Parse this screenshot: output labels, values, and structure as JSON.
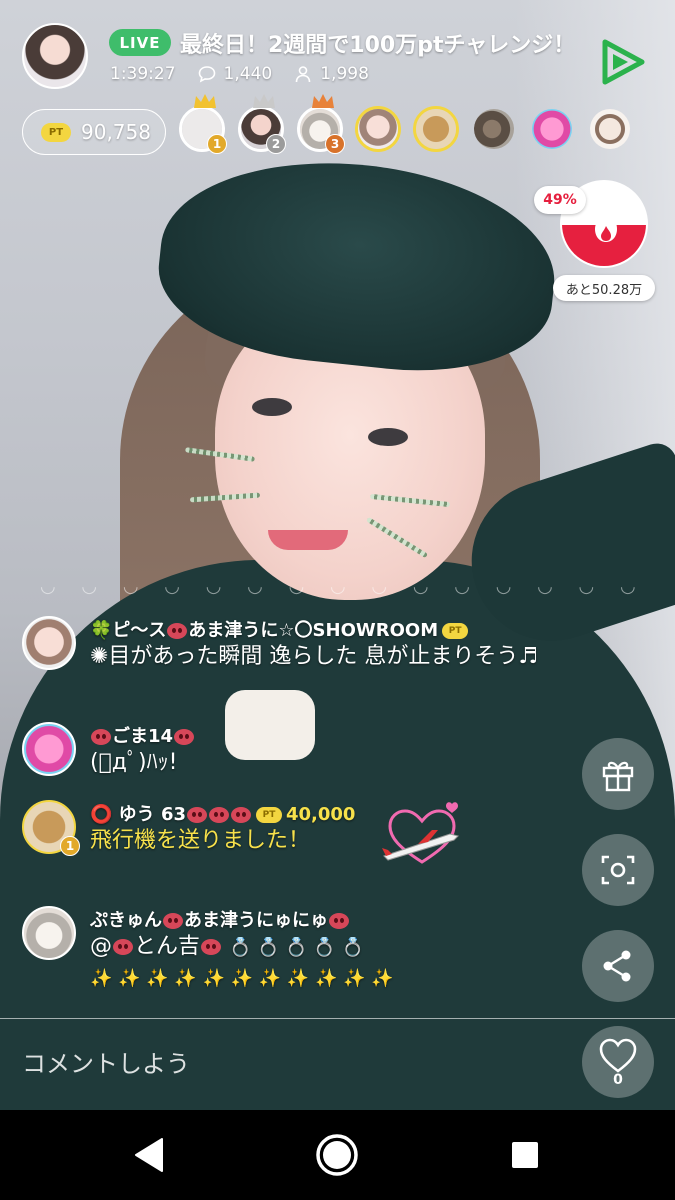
{
  "header": {
    "live_label": "LIVE",
    "title": "最終日！2週間で100万ptチャレンジ！",
    "elapsed_time": "1:39:27",
    "comment_count": "1,440",
    "viewer_count": "1,998"
  },
  "points": {
    "chip": "PT",
    "value": "90,758"
  },
  "ranking": [
    {
      "rank": "1",
      "crown_color": "#f2c230",
      "badge_color": "#e2a92a"
    },
    {
      "rank": "2",
      "crown_color": "#c9c9c9",
      "badge_color": "#9b9b9b"
    },
    {
      "rank": "3",
      "crown_color": "#e8823a",
      "badge_color": "#d8722a"
    }
  ],
  "gauge": {
    "percent_label": "49%",
    "percent": 0.49,
    "remaining": "あと50.28万",
    "color": "#e6203f"
  },
  "comments": [
    {
      "user_prefix": "🍀ピ〜ス",
      "user_mid": "あま津うに☆〇SHOWROOM",
      "pt_badge": "PT",
      "text": "✺目があった瞬間 逸らした 息が止まりそう♬"
    },
    {
      "user_prefix": "",
      "user_mid": "ごま14",
      "text": "(ﾟдﾟ)ﾊｯ!"
    },
    {
      "user_prefix": "⭕ ゆう 63",
      "pt_badge": "PT",
      "points": "40,000",
      "rank": "1",
      "text": "飛行機を送りました！"
    },
    {
      "user_prefix": "ぷきゅん",
      "user_mid": "あま津うにゅにゅ",
      "text_prefix": "@",
      "text_mid": "とん吉",
      "rings": "💍 💍 💍 💍 💍",
      "sparkles": "✨ ✨ ✨ ✨ ✨ ✨ ✨ ✨ ✨ ✨ ✨"
    }
  ],
  "input": {
    "placeholder": "コメントしよう"
  },
  "like_count": "0",
  "icons": {
    "comment": "speech-bubble-icon",
    "viewers": "person-icon",
    "play": "play-triangle-icon",
    "flame": "flame-icon",
    "gift": "gift-icon",
    "screenshot": "screenshot-icon",
    "share": "share-icon",
    "heart": "heart-icon",
    "back": "back-triangle-icon",
    "home": "home-circle-icon",
    "recent": "recent-square-icon"
  },
  "colors": {
    "live_green": "#3fbd6b",
    "play_green": "#2bb24c",
    "pt_yellow": "#f3d640",
    "gift_text": "#f7e14b"
  }
}
